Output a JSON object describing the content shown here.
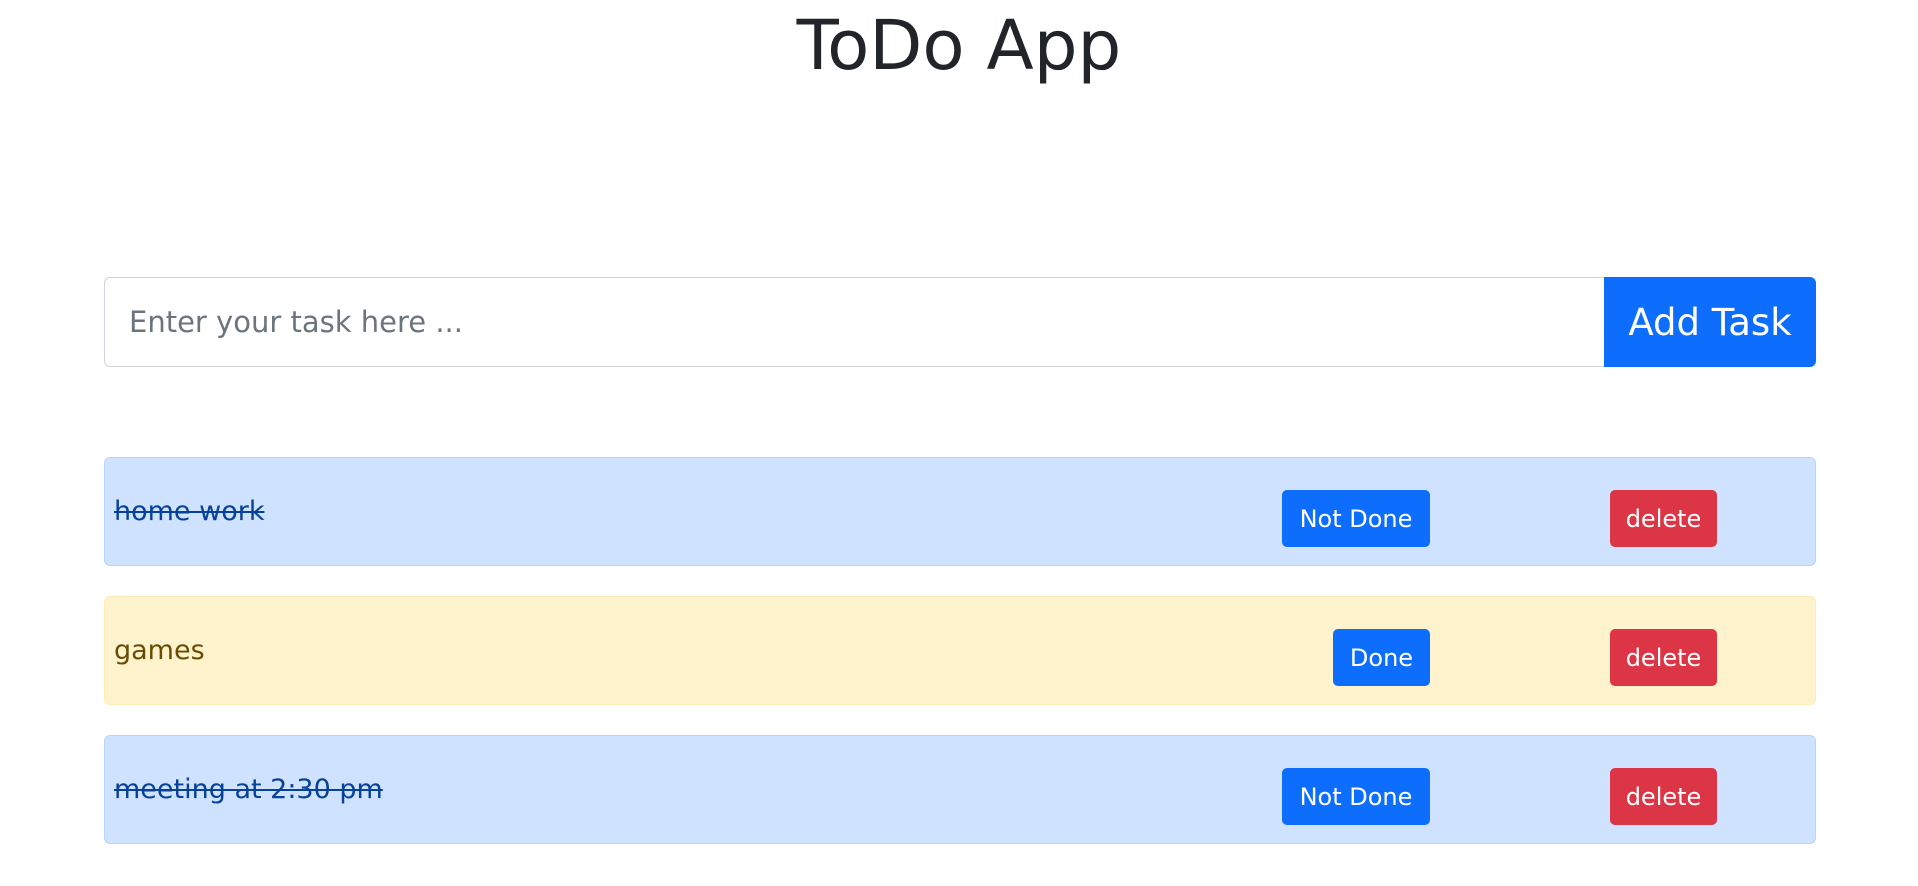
{
  "app": {
    "title": "ToDo App"
  },
  "form": {
    "placeholder": "Enter your task here ...",
    "value": "",
    "add_label": "Add Task"
  },
  "tasks": [
    {
      "text": "home work",
      "status": "done",
      "toggle_label": "Not Done",
      "delete_label": "delete"
    },
    {
      "text": "games",
      "status": "pending",
      "toggle_label": "Done",
      "delete_label": "delete"
    },
    {
      "text": "meeting at 2:30 pm",
      "status": "done",
      "toggle_label": "Not Done",
      "delete_label": "delete"
    }
  ],
  "colors": {
    "primary": "#0d6efd",
    "danger": "#dc3545",
    "done_row": "#cfe2ff",
    "pending_row": "#fff3cd"
  }
}
